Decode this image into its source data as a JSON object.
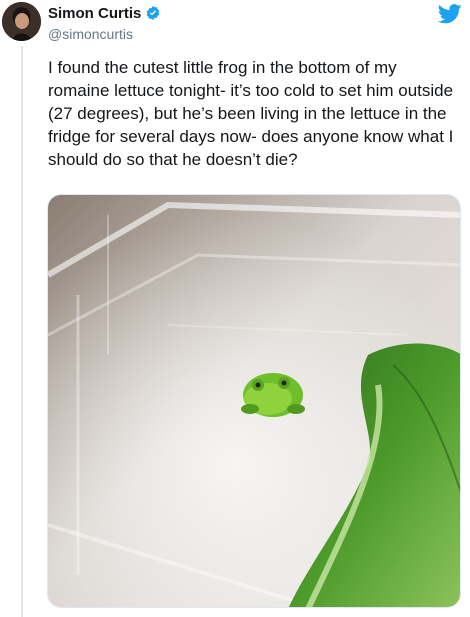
{
  "user": {
    "display_name": "Simon Curtis",
    "handle": "@simoncurtis",
    "verified": true
  },
  "tweet": {
    "text": "I found the cutest little frog in the bottom of my romaine lettuce tonight- it’s too cold to set him outside (27 degrees), but he’s been living in the lettuce in the fridge for several days now- does anyone know what I should do so that he doesn’t die?"
  },
  "icons": {
    "brand": "twitter-bird-icon",
    "verified": "verified-badge-icon"
  },
  "colors": {
    "twitter_blue": "#1da1f2",
    "text": "#14171a",
    "secondary_text": "#657786",
    "divider": "#e1e8ed"
  }
}
